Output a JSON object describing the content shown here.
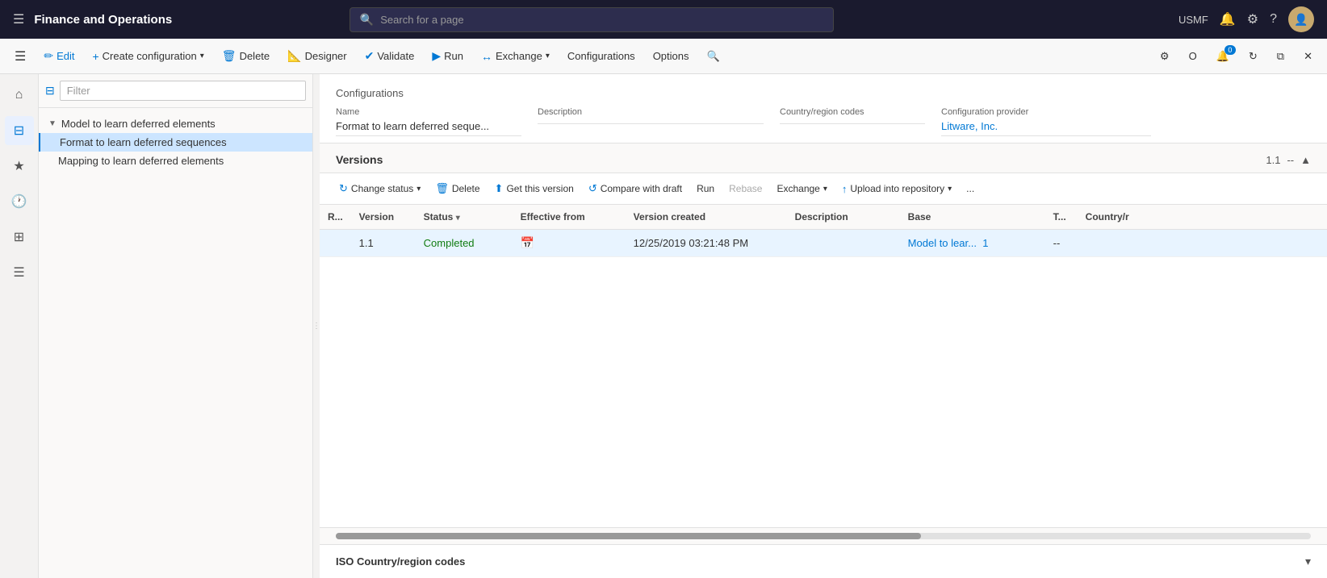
{
  "app": {
    "title": "Finance and Operations",
    "env": "USMF"
  },
  "search": {
    "placeholder": "Search for a page"
  },
  "commandBar": {
    "edit": "Edit",
    "createConfiguration": "Create configuration",
    "delete": "Delete",
    "designer": "Designer",
    "validate": "Validate",
    "run": "Run",
    "exchange": "Exchange",
    "configurations": "Configurations",
    "options": "Options"
  },
  "sidebar": {
    "icons": [
      {
        "name": "home-icon",
        "glyph": "⌂"
      },
      {
        "name": "favorite-icon",
        "glyph": "★"
      },
      {
        "name": "recent-icon",
        "glyph": "🕐"
      },
      {
        "name": "workspace-icon",
        "glyph": "⊞"
      },
      {
        "name": "list-icon",
        "glyph": "☰"
      }
    ]
  },
  "tree": {
    "filter_placeholder": "Filter",
    "items": [
      {
        "label": "Model to learn deferred elements",
        "level": 0,
        "collapsed": false
      },
      {
        "label": "Format to learn deferred sequences",
        "level": 1,
        "selected": true
      },
      {
        "label": "Mapping to learn deferred elements",
        "level": 1,
        "selected": false
      }
    ]
  },
  "configSection": {
    "title": "Configurations",
    "fields": {
      "name_label": "Name",
      "name_value": "Format to learn deferred seque...",
      "description_label": "Description",
      "description_value": "",
      "country_label": "Country/region codes",
      "country_value": "",
      "provider_label": "Configuration provider",
      "provider_value": "Litware, Inc."
    }
  },
  "versionsSection": {
    "title": "Versions",
    "version_indicator": "1.1",
    "dash": "--",
    "toolbar": {
      "changeStatus": "Change status",
      "delete": "Delete",
      "getThisVersion": "Get this version",
      "compareWithDraft": "Compare with draft",
      "run": "Run",
      "rebase": "Rebase",
      "exchange": "Exchange",
      "uploadIntoRepository": "Upload into repository",
      "more": "..."
    },
    "table": {
      "columns": [
        "R...",
        "Version",
        "Status",
        "Effective from",
        "Version created",
        "Description",
        "Base",
        "T...",
        "Country/r"
      ],
      "rows": [
        {
          "r": "",
          "version": "1.1",
          "status": "Completed",
          "effectiveFrom": "",
          "versionCreated": "12/25/2019 03:21:48 PM",
          "description": "",
          "base": "Model to lear...",
          "base_link": "1",
          "t": "--",
          "country": ""
        }
      ]
    }
  },
  "isoSection": {
    "title": "ISO Country/region codes"
  }
}
